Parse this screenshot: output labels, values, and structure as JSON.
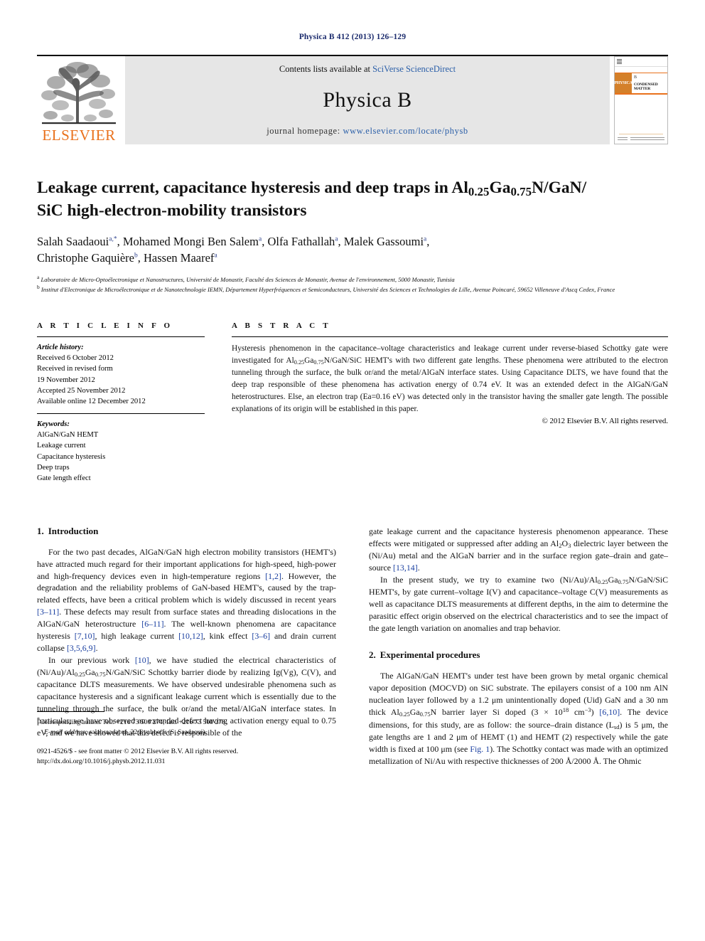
{
  "running_head": "Physica B 412 (2013) 126–129",
  "masthead": {
    "contents_prefix": "Contents lists available at ",
    "contents_link": "SciVerse ScienceDirect",
    "journal_name": "Physica B",
    "homepage_prefix": "journal homepage: ",
    "homepage_url": "www.elsevier.com/locate/physb",
    "publisher_logo_text": "ELSEVIER",
    "cover_physica": "PHYSICA",
    "cover_volume": "B",
    "cover_subtitle": "CONDENSED MATTER",
    "accent_orange": "#E9711C",
    "link_blue": "#2b5fa8"
  },
  "article": {
    "title_line1_a": "Leakage current, capacitance hysteresis and deep traps in Al",
    "title_sub1": "0.25",
    "title_line1_b": "Ga",
    "title_sub2": "0.75",
    "title_line1_c": "N/GaN/",
    "title_line2": "SiC high-electron-mobility transistors",
    "authors": [
      {
        "name": "Salah Saadaoui",
        "marks": "a,*"
      },
      {
        "name": "Mohamed Mongi Ben Salem",
        "marks": "a"
      },
      {
        "name": "Olfa Fathallah",
        "marks": "a"
      },
      {
        "name": "Malek Gassoumi",
        "marks": "a"
      },
      {
        "name": "Christophe Gaquière",
        "marks": "b"
      },
      {
        "name": "Hassen Maaref",
        "marks": "a"
      }
    ],
    "affiliation_a": "Laboratoire de Micro-Optoélectronique et Nanostructures, Université de Monastir, Faculté des Sciences de Monastir, Avenue de l'environnement, 5000 Monastir, Tunisia",
    "affiliation_b": "Institut d'Electronique de Microélectronique et de Nanotechnologie IEMN, Département Hyperfréquences et Semiconducteurs, Université des Sciences et Technologies de Lille, Avenue Poincaré, 59652 Villeneuve d'Ascq Cedex, France"
  },
  "article_info": {
    "heading": "A R T I C L E   I N F O",
    "history_title": "Article history:",
    "history": [
      "Received 6 October 2012",
      "Received in revised form",
      "19 November 2012",
      "Accepted 25 November 2012",
      "Available online 12 December 2012"
    ],
    "keywords_title": "Keywords:",
    "keywords": [
      "AlGaN/GaN HEMT",
      "Leakage current",
      "Capacitance hysteresis",
      "Deep traps",
      "Gate length effect"
    ]
  },
  "abstract": {
    "heading": "A B S T R A C T",
    "text_part1": "Hysteresis phenomenon in the capacitance–voltage characteristics and leakage current under reverse-biased Schottky gate were investigated for Al",
    "sub1": "0.25",
    "text_part2": "Ga",
    "sub2": "0.75",
    "text_part3": "N/GaN/SiC HEMT's with two different gate lengths. These phenomena were attributed to the electron tunneling through the surface, the bulk or/and the metal/AlGaN interface states. Using Capacitance DLTS, we have found that the deep trap responsible of these phenomena has activation energy of 0.74 eV. It was an extended defect in the AlGaN/GaN heterostructures. Else, an electron trap (Ea=0.16 eV) was detected only in the transistor having the smaller gate length. The possible explanations of its origin will be established in this paper.",
    "copyright": "© 2012 Elsevier B.V. All rights reserved."
  },
  "sections": {
    "introduction": {
      "number": "1.",
      "title": "Introduction",
      "p1_a": "For the two past decades, AlGaN/GaN high electron mobility transistors (HEMT's) have attracted much regard for their important applications for high-speed, high-power and high-frequency devices even in high-temperature regions ",
      "p1_cite1": "[1,2]",
      "p1_b": ". However, the degradation and the reliability problems of GaN-based HEMT's, caused by the trap-related effects, have been a critical problem which is widely discussed in recent years ",
      "p1_cite2": "[3–11]",
      "p1_c": ". These defects may result from surface states and threading dislocations in the AlGaN/GaN heterostructure ",
      "p1_cite3": "[6–11]",
      "p1_d": ". The well-known phenomena are capacitance hysteresis ",
      "p1_cite4": "[7,10]",
      "p1_e": ", high leakage current ",
      "p1_cite5": "[10,12]",
      "p1_f": ", kink effect ",
      "p1_cite6": "[3–6]",
      "p1_g": " and drain current collapse ",
      "p1_cite7": "[3,5,6,9]",
      "p1_h": ".",
      "p2_a": "In our previous work ",
      "p2_cite1": "[10]",
      "p2_b": ", we have studied the electrical characteristics of (Ni/Au)/Al",
      "p2_sub1": "0.25",
      "p2_c": "Ga",
      "p2_sub2": "0.75",
      "p2_d": "N/GaN/SiC Schottky barrier diode by realizing Ig(Vg), C(V), and capacitance DLTS measurements. We have observed undesirable phenomena such as capacitance hysteresis and a significant leakage current which is essentially due to the tunneling through the surface, the bulk or/and the metal/AlGaN interface states. In particular, we have observed an extended defect having activation energy equal to 0.75 eV, and we have showed that this defect is responsible of the",
      "p3_a": "gate leakage current and the capacitance hysteresis phenomenon appearance. These effects were mitigated or suppressed after adding an Al",
      "p3_sub1": "2",
      "p3_b": "O",
      "p3_sub2": "3",
      "p3_c": " dielectric layer between the (Ni/Au) metal and the AlGaN barrier and in the surface region gate–drain and gate–source ",
      "p3_cite1": "[13,14]",
      "p3_d": ".",
      "p4_a": "In the present study, we try to examine two (Ni/Au)/Al",
      "p4_sub1": "0.25",
      "p4_b": "Ga",
      "p4_sub2": "0.75",
      "p4_c": "N/GaN/SiC HEMT's, by gate current–voltage I(V) and capacitance–voltage C(V) measurements as well as capacitance DLTS measurements at different depths, in the aim to determine the parasitic effect origin observed on the electrical characteristics and to see the impact of the gate length variation on anomalies and trap behavior."
    },
    "experimental": {
      "number": "2.",
      "title": "Experimental procedures",
      "p1_a": "The AlGaN/GaN HEMT's under test have been grown by metal organic chemical vapor deposition (MOCVD) on SiC substrate. The epilayers consist of a 100 nm AlN nucleation layer followed by a 1.2 μm unintentionally doped (Uid) GaN and a 30 nm thick Al",
      "p1_sub1": "0.25",
      "p1_b": "Ga",
      "p1_sub2": "0.75",
      "p1_c": "N barrier layer Si doped (3 × 10",
      "p1_sup1": "18",
      "p1_d": " cm",
      "p1_sup2": "−3",
      "p1_e": ") ",
      "p1_cite1": "[6,10]",
      "p1_f": ". The device dimensions, for this study, are as follow: the source–drain distance (L",
      "p1_sub3": "sd",
      "p1_g": ") is 5 μm, the gate lengths are 1 and 2 μm of HEMT (1) and HEMT (2) respectively while the gate width is fixed at 100 μm (see ",
      "p1_cite2": "Fig. 1",
      "p1_h": "). The Schottky contact was made with an optimized metallization of Ni/Au with respective thicknesses of 200 Å/2000 Å. The Ohmic"
    }
  },
  "footnotes": {
    "corresponding": "Corresponding author. Tel.: +216 73 500 274; fax: +216 73 500 278.",
    "email_label": "E-mail address:",
    "email_value": " salahsaadaoui_22@yahoo.fr (S. Saadaoui).",
    "issn_line": "0921-4526/$ - see front matter © 2012 Elsevier B.V. All rights reserved.",
    "doi_line": "http://dx.doi.org/10.1016/j.physb.2012.11.031"
  }
}
